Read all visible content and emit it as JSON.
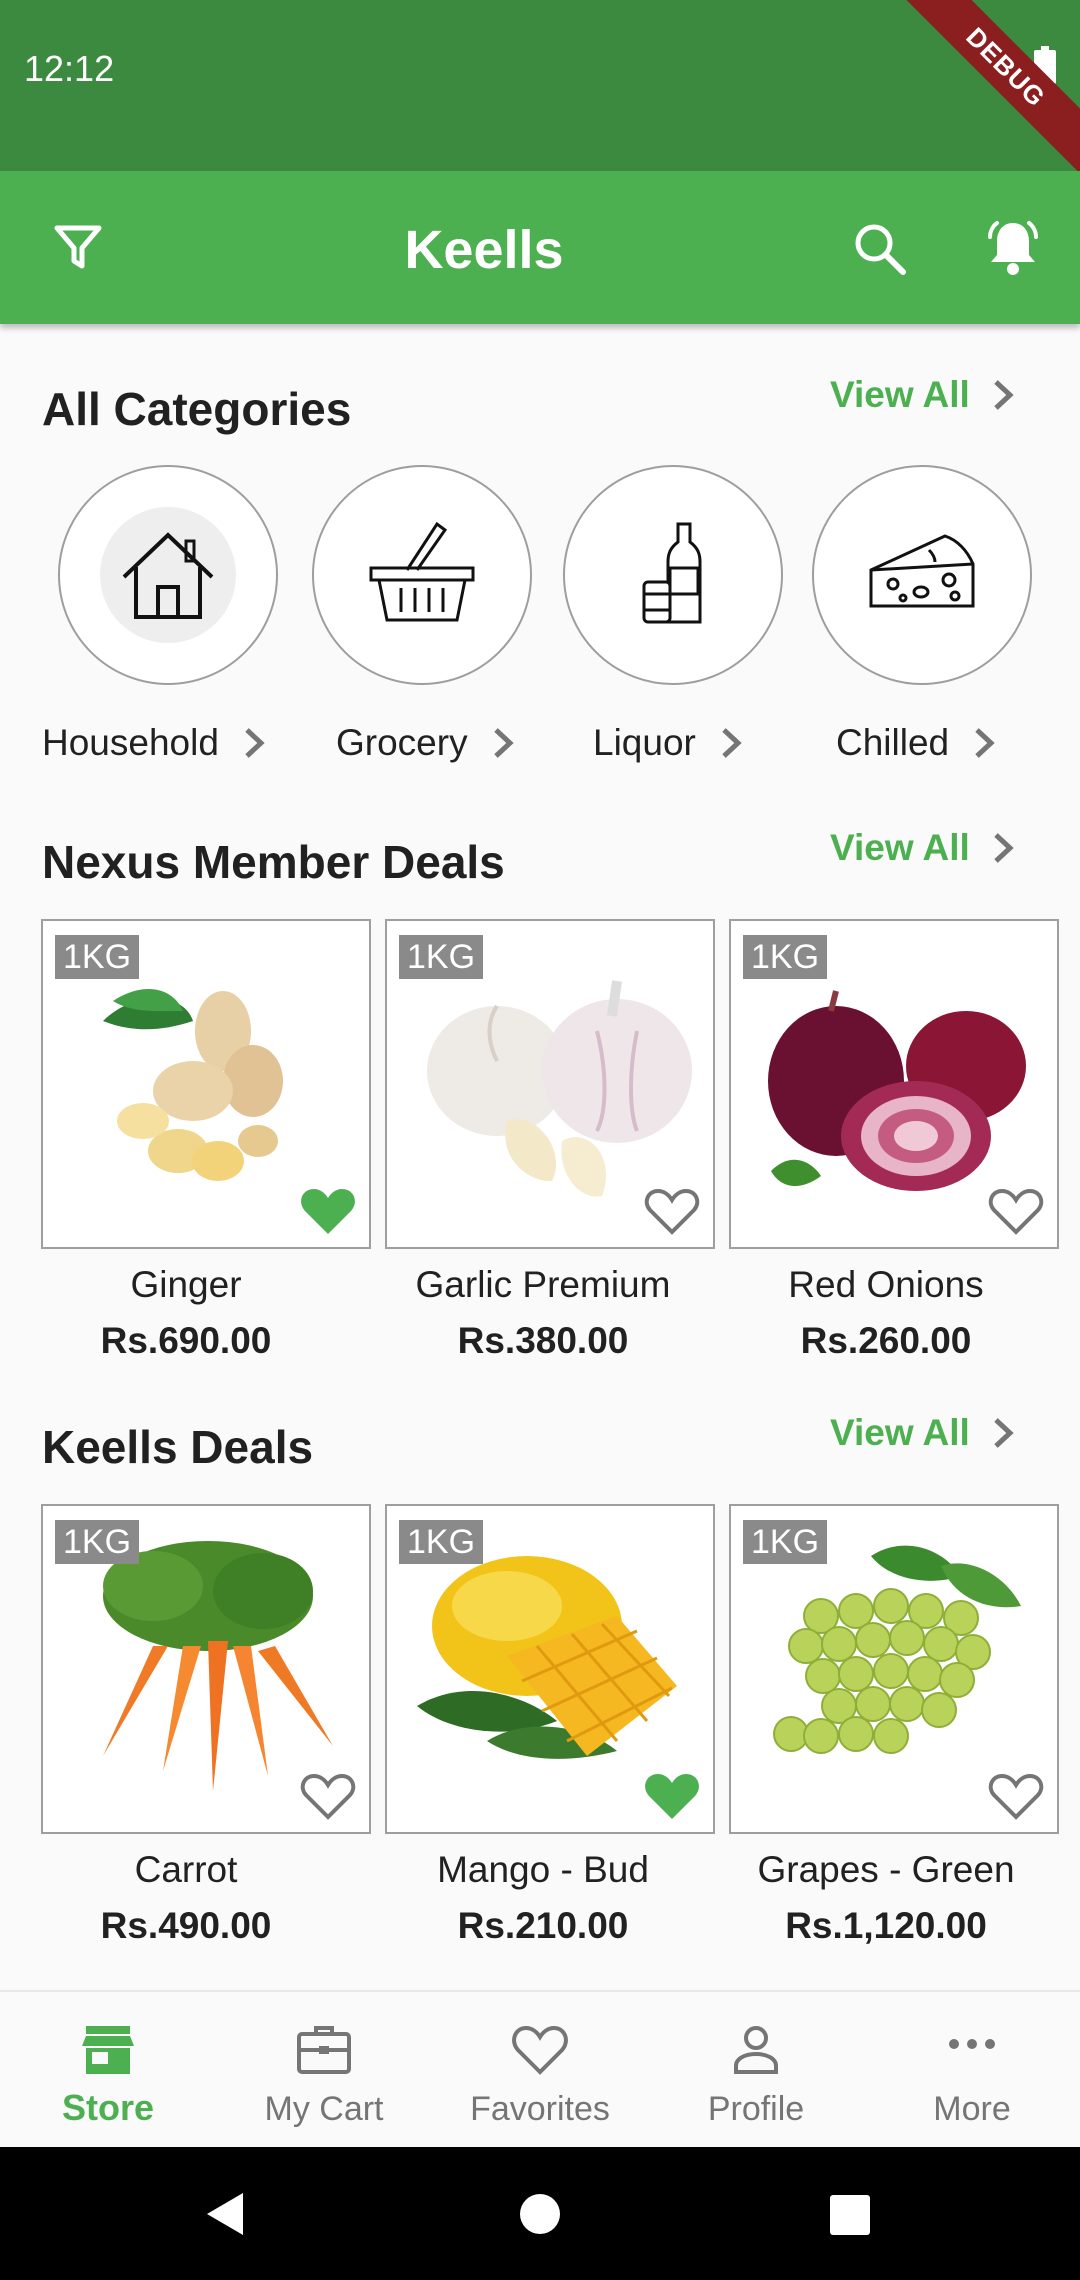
{
  "status_bar": {
    "time": "12:12",
    "debug_label": "DEBUG"
  },
  "app_bar": {
    "title": "Keells"
  },
  "categories_section": {
    "title": "All Categories",
    "view_all": "View All",
    "items": [
      {
        "label": "Household",
        "icon": "house-icon"
      },
      {
        "label": "Grocery",
        "icon": "basket-icon"
      },
      {
        "label": "Liquor",
        "icon": "bottle-icon"
      },
      {
        "label": "Chilled",
        "icon": "cheese-icon"
      }
    ]
  },
  "nexus_deals": {
    "title": "Nexus Member Deals",
    "view_all": "View All",
    "products": [
      {
        "weight": "1KG",
        "name": "Ginger",
        "price": "Rs.690.00",
        "favorite": true
      },
      {
        "weight": "1KG",
        "name": "Garlic Premium",
        "price": "Rs.380.00",
        "favorite": false
      },
      {
        "weight": "1KG",
        "name": "Red Onions",
        "price": "Rs.260.00",
        "favorite": false
      }
    ]
  },
  "keells_deals": {
    "title": "Keells Deals",
    "view_all": "View All",
    "products": [
      {
        "weight": "1KG",
        "name": "Carrot",
        "price": "Rs.490.00",
        "favorite": false
      },
      {
        "weight": "1KG",
        "name": "Mango - Bud",
        "price": "Rs.210.00",
        "favorite": true
      },
      {
        "weight": "1KG",
        "name": "Grapes - Green",
        "price": "Rs.1,120.00",
        "favorite": false
      }
    ]
  },
  "bottom_nav": {
    "items": [
      {
        "label": "Store",
        "icon": "store-icon",
        "active": true
      },
      {
        "label": "My Cart",
        "icon": "briefcase-icon",
        "active": false
      },
      {
        "label": "Favorites",
        "icon": "heart-icon",
        "active": false
      },
      {
        "label": "Profile",
        "icon": "person-icon",
        "active": false
      },
      {
        "label": "More",
        "icon": "more-dots-icon",
        "active": false
      }
    ]
  },
  "colors": {
    "primary": "#4caf50",
    "status_bar": "#3c8a3f",
    "favorite": "#4caf50",
    "debug": "#8b1e1e"
  }
}
